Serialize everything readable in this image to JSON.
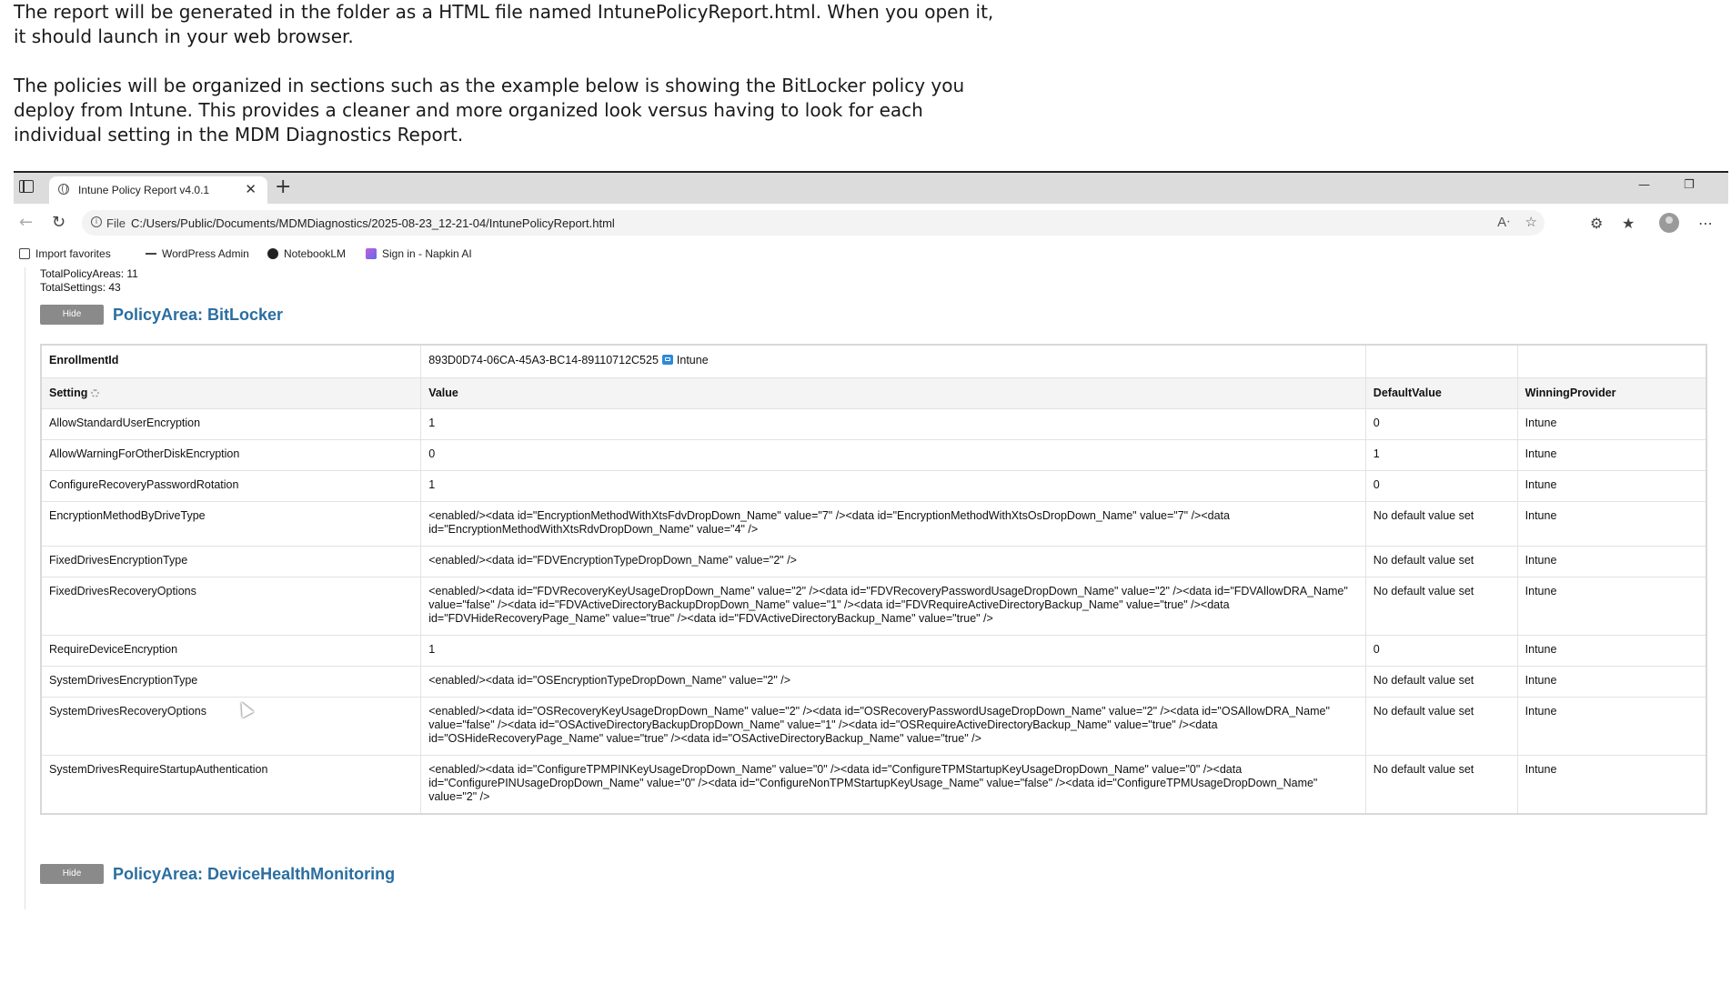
{
  "intro": {
    "para1": "The report will be generated in the folder as a HTML file named IntunePolicyReport.html. When you open it, it should launch in your web browser.",
    "para2": "The policies will be organized in sections such as the example below is showing the BitLocker policy you deploy from Intune. This provides a cleaner and more organized look versus having to look for each individual setting in the MDM Diagnostics Report."
  },
  "browser": {
    "tab_title": "Intune Policy Report v4.0.1",
    "tab_close": "✕",
    "new_tab": "+",
    "url_scheme": "File",
    "url": "C:/Users/Public/Documents/MDMDiagnostics/2025-08-23_12-21-04/IntunePolicyReport.html",
    "favorites": [
      "Import favorites",
      "WordPress Admin",
      "NotebookLM",
      "Sign in - Napkin AI"
    ]
  },
  "report": {
    "total_policy_areas": "TotalPolicyAreas: 11",
    "total_settings": "TotalSettings: 43",
    "hide_label": "Hide",
    "area1_title": "PolicyArea: BitLocker",
    "area2_title": "PolicyArea: DeviceHealthMonitoring",
    "enrollment_label": "EnrollmentId",
    "enrollment_id": "893D0D74-06CA-45A3-BC14-89110712C525",
    "enrollment_provider": "Intune",
    "headers": {
      "setting": "Setting",
      "value": "Value",
      "default": "DefaultValue",
      "provider": "WinningProvider"
    },
    "rows": [
      {
        "setting": "AllowStandardUserEncryption",
        "value": "1",
        "default": "0",
        "provider": "Intune"
      },
      {
        "setting": "AllowWarningForOtherDiskEncryption",
        "value": "0",
        "default": "1",
        "provider": "Intune"
      },
      {
        "setting": "ConfigureRecoveryPasswordRotation",
        "value": "1",
        "default": "0",
        "provider": "Intune"
      },
      {
        "setting": "EncryptionMethodByDriveType",
        "value": "<enabled/><data id=\"EncryptionMethodWithXtsFdvDropDown_Name\" value=\"7\" /><data id=\"EncryptionMethodWithXtsOsDropDown_Name\" value=\"7\" /><data id=\"EncryptionMethodWithXtsRdvDropDown_Name\" value=\"4\" />",
        "default": "No default value set",
        "provider": "Intune"
      },
      {
        "setting": "FixedDrivesEncryptionType",
        "value": "<enabled/><data id=\"FDVEncryptionTypeDropDown_Name\" value=\"2\" />",
        "default": "No default value set",
        "provider": "Intune"
      },
      {
        "setting": "FixedDrivesRecoveryOptions",
        "value": "<enabled/><data id=\"FDVRecoveryKeyUsageDropDown_Name\" value=\"2\" /><data id=\"FDVRecoveryPasswordUsageDropDown_Name\" value=\"2\" /><data id=\"FDVAllowDRA_Name\" value=\"false\" /><data id=\"FDVActiveDirectoryBackupDropDown_Name\" value=\"1\" /><data id=\"FDVRequireActiveDirectoryBackup_Name\" value=\"true\" /><data id=\"FDVHideRecoveryPage_Name\" value=\"true\" /><data id=\"FDVActiveDirectoryBackup_Name\" value=\"true\" />",
        "default": "No default value set",
        "provider": "Intune"
      },
      {
        "setting": "RequireDeviceEncryption",
        "value": "1",
        "default": "0",
        "provider": "Intune"
      },
      {
        "setting": "SystemDrivesEncryptionType",
        "value": "<enabled/><data id=\"OSEncryptionTypeDropDown_Name\" value=\"2\" />",
        "default": "No default value set",
        "provider": "Intune"
      },
      {
        "setting": "SystemDrivesRecoveryOptions",
        "value": "<enabled/><data id=\"OSRecoveryKeyUsageDropDown_Name\" value=\"2\" /><data id=\"OSRecoveryPasswordUsageDropDown_Name\" value=\"2\" /><data id=\"OSAllowDRA_Name\" value=\"false\" /><data id=\"OSActiveDirectoryBackupDropDown_Name\" value=\"1\" /><data id=\"OSRequireActiveDirectoryBackup_Name\" value=\"true\" /><data id=\"OSHideRecoveryPage_Name\" value=\"true\" /><data id=\"OSActiveDirectoryBackup_Name\" value=\"true\" />",
        "default": "No default value set",
        "provider": "Intune"
      },
      {
        "setting": "SystemDrivesRequireStartupAuthentication",
        "value": "<enabled/><data id=\"ConfigureTPMPINKeyUsageDropDown_Name\" value=\"0\" /><data id=\"ConfigureTPMStartupKeyUsageDropDown_Name\" value=\"0\" /><data id=\"ConfigurePINUsageDropDown_Name\" value=\"0\" /><data id=\"ConfigureNonTPMStartupKeyUsage_Name\" value=\"false\" /><data id=\"ConfigureTPMUsageDropDown_Name\" value=\"2\" />",
        "default": "No default value set",
        "provider": "Intune"
      }
    ]
  }
}
